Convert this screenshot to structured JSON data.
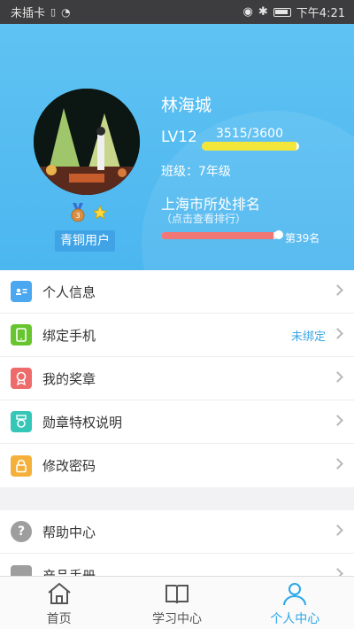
{
  "status": {
    "carrier": "未插卡",
    "time": "下午4:21"
  },
  "profile": {
    "name": "林海城",
    "level": "LV12",
    "xp_text": "3515/3600",
    "xp_progress": 0.976,
    "grade": "班级：7年级",
    "badge_title": "青铜用户",
    "rank_title": "上海市所处排名",
    "rank_hint": "（点击查看排行）",
    "rank_text": "第39名",
    "rank_progress": 0.96
  },
  "menu": {
    "items": [
      {
        "label": "个人信息",
        "color": "#4aa7f0"
      },
      {
        "label": "绑定手机",
        "value": "未绑定",
        "color": "#67c52f"
      },
      {
        "label": "我的奖章",
        "color": "#ee6b6b"
      },
      {
        "label": "勋章特权说明",
        "color": "#34c7b7"
      },
      {
        "label": "修改密码",
        "color": "#f5b03b"
      }
    ],
    "secondary": [
      {
        "label": "帮助中心",
        "color": "#9e9e9e"
      },
      {
        "label": "产品手册",
        "color": "#9e9e9e"
      }
    ]
  },
  "tabs": [
    {
      "label": "首页"
    },
    {
      "label": "学习中心"
    },
    {
      "label": "个人中心"
    }
  ]
}
